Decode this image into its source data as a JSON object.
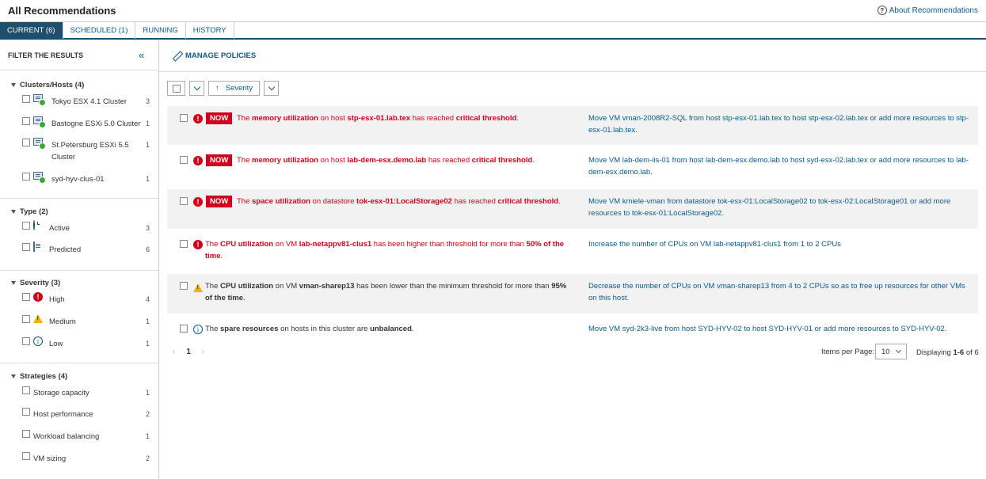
{
  "header": {
    "title": "All Recommendations",
    "about": "About Recommendations"
  },
  "tabs": [
    {
      "label": "CURRENT (6)",
      "active": true
    },
    {
      "label": "SCHEDULED (1)",
      "active": false
    },
    {
      "label": "RUNNING",
      "active": false
    },
    {
      "label": "HISTORY",
      "active": false
    }
  ],
  "sidebar": {
    "title": "FILTER THE RESULTS",
    "groups": {
      "clusters": {
        "title": "Clusters/Hosts (4)",
        "items": [
          {
            "label": "Tokyo ESX 4.1 Cluster",
            "count": "3"
          },
          {
            "label": "Bastogne ESXi 5.0 Cluster",
            "count": "1"
          },
          {
            "label": "St.Petersburg ESXi 5.5 Cluster",
            "count": "1"
          },
          {
            "label": "syd-hyv-clus-01",
            "count": "1"
          }
        ]
      },
      "type": {
        "title": "Type (2)",
        "items": [
          {
            "label": "Active",
            "count": "3"
          },
          {
            "label": "Predicted",
            "count": "6"
          }
        ]
      },
      "severity": {
        "title": "Severity (3)",
        "items": [
          {
            "label": "High",
            "count": "4"
          },
          {
            "label": "Medium",
            "count": "1"
          },
          {
            "label": "Low",
            "count": "1"
          }
        ]
      },
      "strategies": {
        "title": "Strategies (4)",
        "items": [
          {
            "label": "Storage capacity",
            "count": "1"
          },
          {
            "label": "Host performance",
            "count": "2"
          },
          {
            "label": "Workload balancing",
            "count": "1"
          },
          {
            "label": "VM sizing",
            "count": "2"
          }
        ]
      }
    }
  },
  "main": {
    "manage": "MANAGE POLICIES",
    "sort_label": "Severity",
    "now_badge": "NOW",
    "rows": [
      {
        "m": [
          "The ",
          "memory utilization",
          " on host ",
          "stp-esx-01.lab.tex",
          " has reached ",
          "critical threshold",
          "."
        ],
        "action": "Move VM vman-2008R2-SQL from host stp-esx-01.lab.tex to host stp-esx-02.lab.tex or add more resources to stp-esx-01.lab.tex."
      },
      {
        "m": [
          "The ",
          "memory utilization",
          " on host ",
          "lab-dem-esx.demo.lab",
          " has reached ",
          "critical threshold",
          "."
        ],
        "action": "Move VM lab-dem-iis-01 from host lab-dem-esx.demo.lab to host syd-esx-02.lab.tex or add more resources to lab-dem-esx.demo.lab."
      },
      {
        "m": [
          "The ",
          "space utilization",
          " on datastore ",
          "tok-esx-01:LocalStorage02",
          " has reached ",
          "critical threshold",
          "."
        ],
        "action": "Move VM kmiele-vman from datastore tok-esx-01:LocalStorage02 to tok-esx-02:LocalStorage01 or add more resources to tok-esx-01:LocalStorage02."
      },
      {
        "m": [
          "The ",
          "CPU utilization",
          " on VM ",
          "lab-netappv81-clus1",
          " has been higher than threshold for more than ",
          "50% of the time",
          "."
        ],
        "action": "Increase the number of CPUs on VM lab-netappv81-clus1 from 1 to 2 CPUs"
      },
      {
        "m": [
          "The ",
          "CPU utilization",
          " on VM ",
          "vman-sharep13",
          " has been lower than the minimum threshold for more than ",
          "95% of the time",
          "."
        ],
        "action": "Decrease the number of CPUs on VM vman-sharep13 from 4 to 2 CPUs so as to free up resources for other VMs on this host."
      },
      {
        "m": [
          "The ",
          "spare resources",
          " on hosts in this cluster are ",
          "unbalanced",
          "."
        ],
        "action": "Move VM syd-2k3-live from host SYD-HYV-02 to host SYD-HYV-01 or add more resources to SYD-HYV-02."
      }
    ],
    "pager": {
      "prev": "‹",
      "page": "1",
      "next": "›"
    },
    "items_per_page_label": "Items per Page:",
    "items_per_page_value": "10",
    "displaying": {
      "prefix": "Displaying ",
      "range": "1-6",
      "suffix": " of 6"
    }
  }
}
